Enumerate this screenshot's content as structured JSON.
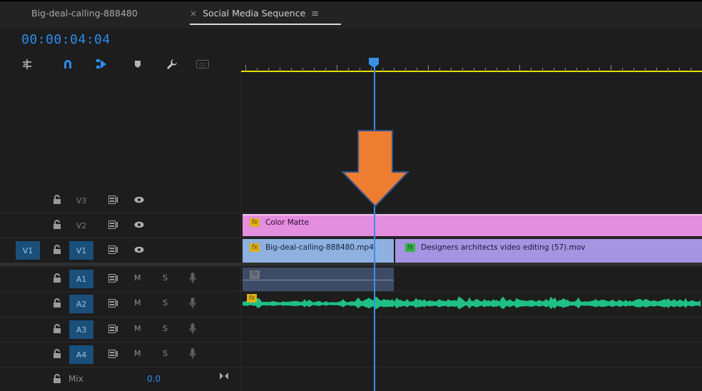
{
  "tabs": [
    {
      "label": "Big-deal-calling-888480"
    },
    {
      "label": "Social Media Sequence",
      "close": "×",
      "menu": "≡"
    }
  ],
  "timecode": "00:00:04:04",
  "toolbar": [
    {
      "icon": "insert-nest-icon",
      "active": false
    },
    {
      "icon": "snap-magnet-icon",
      "active": true
    },
    {
      "icon": "linked-selection-icon",
      "active": true
    },
    {
      "icon": "add-marker-icon",
      "active": false
    },
    {
      "icon": "timeline-settings-wrench-icon",
      "active": false
    },
    {
      "icon": "captions-cc-icon",
      "active": false
    }
  ],
  "tracks": {
    "video": [
      {
        "name": "V3"
      },
      {
        "name": "V2"
      },
      {
        "name": "V1",
        "source_patch": "V1",
        "targeted": true
      }
    ],
    "audio": [
      {
        "name": "A1",
        "mute": "M",
        "solo": "S"
      },
      {
        "name": "A2",
        "mute": "M",
        "solo": "S"
      },
      {
        "name": "A3",
        "mute": "M",
        "solo": "S"
      },
      {
        "name": "A4",
        "mute": "M",
        "solo": "S"
      }
    ],
    "mix": {
      "label": "Mix",
      "value": "0.0"
    }
  },
  "clips": {
    "color_matte": {
      "label": "Color Matte",
      "fx": "fx"
    },
    "big_deal": {
      "label": "Big-deal-calling-888480.mp4",
      "fx": "fx"
    },
    "designers": {
      "label": "Designers architects video editing (57).mov",
      "fx": "fx"
    },
    "a1_audio": {
      "fx": "fx"
    },
    "a2_audio": {
      "fx": "fx"
    }
  },
  "colors": {
    "accent_blue": "#2d8ceb",
    "ruler_yellow": "#e9e100",
    "color_matte_pink": "#e48ee0",
    "video_clip_blue": "#8fb1e0",
    "video_clip_purple": "#a594e2",
    "audio_green": "#1fbf86",
    "annotation_orange": "#ed7d31"
  },
  "annotation": {
    "icon": "down-arrow-icon"
  }
}
